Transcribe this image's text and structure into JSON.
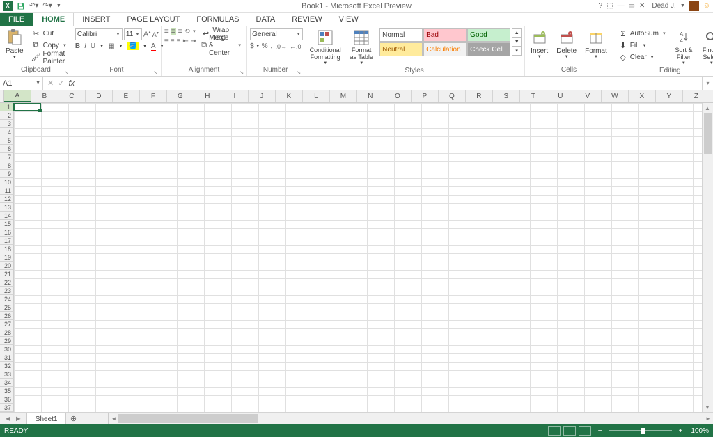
{
  "title": "Book1 - Microsoft Excel Preview",
  "user": "Dead J.",
  "tabs": [
    "FILE",
    "HOME",
    "INSERT",
    "PAGE LAYOUT",
    "FORMULAS",
    "DATA",
    "REVIEW",
    "VIEW"
  ],
  "active_tab": "HOME",
  "clipboard": {
    "paste": "Paste",
    "cut": "Cut",
    "copy": "Copy",
    "painter": "Format Painter",
    "label": "Clipboard"
  },
  "font": {
    "name": "Calibri",
    "size": "11",
    "label": "Font"
  },
  "alignment": {
    "wrap": "Wrap Text",
    "merge": "Merge & Center",
    "label": "Alignment"
  },
  "number": {
    "format": "General",
    "label": "Number"
  },
  "styles": {
    "cond": "Conditional Formatting",
    "table": "Format as Table",
    "label": "Styles",
    "items": [
      "Normal",
      "Bad",
      "Good",
      "Neutral",
      "Calculation",
      "Check Cell"
    ]
  },
  "cells": {
    "insert": "Insert",
    "delete": "Delete",
    "format": "Format",
    "label": "Cells"
  },
  "editing": {
    "autosum": "AutoSum",
    "fill": "Fill",
    "clear": "Clear",
    "sort": "Sort & Filter",
    "find": "Find & Select",
    "label": "Editing"
  },
  "namebox": "A1",
  "columns": [
    "A",
    "B",
    "C",
    "D",
    "E",
    "F",
    "G",
    "H",
    "I",
    "J",
    "K",
    "L",
    "M",
    "N",
    "O",
    "P",
    "Q",
    "R",
    "S",
    "T",
    "U",
    "V",
    "W",
    "X",
    "Y",
    "Z"
  ],
  "rows": 37,
  "active": {
    "col": "A",
    "row": 1
  },
  "sheet": "Sheet1",
  "status": "READY",
  "zoom": "100%"
}
